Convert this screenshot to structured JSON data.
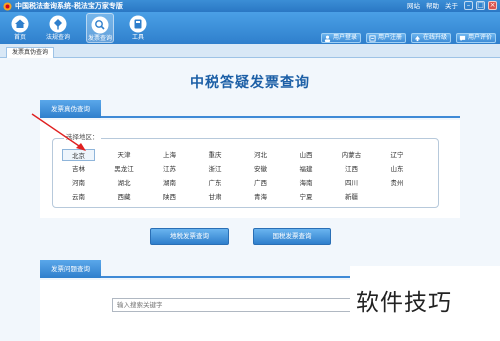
{
  "window": {
    "title": "中国税法查询系统-税法宝万家专版",
    "top_links": [
      "网站",
      "帮助",
      "关于"
    ],
    "minimize": "–",
    "maximize": "□",
    "close": "×"
  },
  "toolbar": {
    "items": [
      {
        "label": "首页",
        "icon": "home-icon"
      },
      {
        "label": "法规查询",
        "icon": "law-search-icon"
      },
      {
        "label": "发票查询",
        "icon": "invoice-search-icon"
      },
      {
        "label": "工具",
        "icon": "tools-icon"
      }
    ],
    "active_index": 2,
    "right_buttons": [
      {
        "label": "用户登录",
        "icon": "login-icon"
      },
      {
        "label": "用户注册",
        "icon": "register-icon"
      },
      {
        "label": "在线升级",
        "icon": "upgrade-icon"
      },
      {
        "label": "用户评价",
        "icon": "review-icon"
      }
    ]
  },
  "tabs": [
    {
      "label": "发票真伪查询"
    }
  ],
  "main": {
    "title": "中税答疑发票查询",
    "section1": {
      "label": "发票真伪查询"
    },
    "region_legend": "选择地区：",
    "regions": [
      [
        "北京",
        "天津",
        "上海",
        "重庆",
        "河北",
        "山西",
        "内蒙古",
        "辽宁"
      ],
      [
        "吉林",
        "黑龙江",
        "江苏",
        "浙江",
        "安徽",
        "福建",
        "江西",
        "山东"
      ],
      [
        "河南",
        "湖北",
        "湖南",
        "广东",
        "广西",
        "海南",
        "四川",
        "贵州"
      ],
      [
        "云南",
        "西藏",
        "陕西",
        "甘肃",
        "青海",
        "宁夏",
        "新疆"
      ]
    ],
    "selected_region": "北京",
    "buttons": {
      "local_tax": "地税发票查询",
      "national_tax": "国税发票查询"
    },
    "section2": {
      "label": "发票问题查询"
    },
    "search": {
      "placeholder": "输入搜索关键字"
    }
  },
  "watermark": "软件技巧",
  "colors": {
    "brand_blue": "#2f7fcc",
    "title_blue": "#1c5fa6",
    "annotation_red": "#e02020"
  }
}
